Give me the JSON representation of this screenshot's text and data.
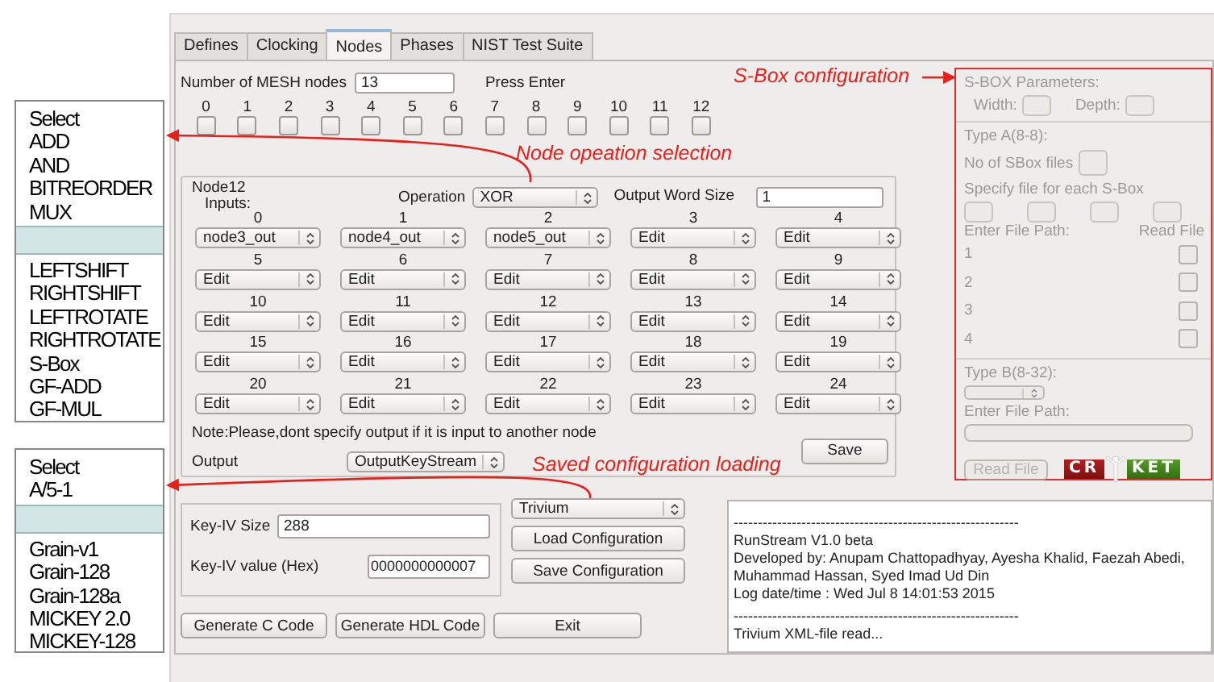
{
  "operation_list": {
    "items": [
      {
        "kind": "option",
        "label": "Select",
        "selected": false
      },
      {
        "kind": "option",
        "label": "ADD",
        "selected": false
      },
      {
        "kind": "option",
        "label": "AND",
        "selected": false
      },
      {
        "kind": "option",
        "label": "BITREORDER",
        "selected": false
      },
      {
        "kind": "option",
        "label": "MUX",
        "selected": false
      },
      {
        "kind": "blank",
        "selected": true
      },
      {
        "kind": "option",
        "label": "LEFTSHIFT",
        "selected": false
      },
      {
        "kind": "option",
        "label": "RIGHTSHIFT",
        "selected": false
      },
      {
        "kind": "option",
        "label": "LEFTROTATE",
        "selected": false
      },
      {
        "kind": "option",
        "label": "RIGHTROTATE",
        "selected": false
      },
      {
        "kind": "option",
        "label": "S-Box",
        "selected": false
      },
      {
        "kind": "option",
        "label": "GF-ADD",
        "selected": false
      },
      {
        "kind": "option",
        "label": "GF-MUL",
        "selected": false
      }
    ]
  },
  "cipher_list": {
    "items": [
      {
        "kind": "option",
        "label": "Select",
        "selected": false
      },
      {
        "kind": "option",
        "label": "A/5-1",
        "selected": false
      },
      {
        "kind": "blank",
        "selected": true
      },
      {
        "kind": "option",
        "label": "Grain-v1",
        "selected": false
      },
      {
        "kind": "option",
        "label": "Grain-128",
        "selected": false
      },
      {
        "kind": "option",
        "label": "Grain-128a",
        "selected": false
      },
      {
        "kind": "option",
        "label": "MICKEY 2.0",
        "selected": false
      },
      {
        "kind": "option",
        "label": "MICKEY-128",
        "selected": false
      }
    ]
  },
  "annotations": [
    {
      "text": "S-Box configuration"
    },
    {
      "text": "Node opeation selection"
    },
    {
      "text": "Saved configuration loading"
    }
  ],
  "window": {
    "tabs": [
      {
        "label": "Defines",
        "selected": false
      },
      {
        "label": "Clocking",
        "selected": false
      },
      {
        "label": "Nodes",
        "selected": true
      },
      {
        "label": "Phases",
        "selected": false
      },
      {
        "label": "NIST Test Suite",
        "selected": false
      }
    ],
    "mesh": {
      "label": "Number of MESH nodes",
      "value": "13",
      "hint": "Press Enter"
    },
    "node_checkboxes": [
      {
        "label": "0",
        "checked": false
      },
      {
        "label": "1",
        "checked": false
      },
      {
        "label": "2",
        "checked": false
      },
      {
        "label": "3",
        "checked": false
      },
      {
        "label": "4",
        "checked": false
      },
      {
        "label": "5",
        "checked": false
      },
      {
        "label": "6",
        "checked": false
      },
      {
        "label": "7",
        "checked": false
      },
      {
        "label": "8",
        "checked": false
      },
      {
        "label": "9",
        "checked": false
      },
      {
        "label": "10",
        "checked": false
      },
      {
        "label": "11",
        "checked": false
      },
      {
        "label": "12",
        "checked": false
      }
    ],
    "node": {
      "title": "Node12",
      "inputs_label": "Inputs:",
      "operation_label": "Operation",
      "operation": "XOR",
      "word_size_label": "Output Word Size",
      "word_size": "1",
      "inputs": [
        {
          "index": "0",
          "value": "node3_out"
        },
        {
          "index": "1",
          "value": "node4_out"
        },
        {
          "index": "2",
          "value": "node5_out"
        },
        {
          "index": "3",
          "value": "Edit"
        },
        {
          "index": "4",
          "value": "Edit"
        },
        {
          "index": "5",
          "value": "Edit"
        },
        {
          "index": "6",
          "value": "Edit"
        },
        {
          "index": "7",
          "value": "Edit"
        },
        {
          "index": "8",
          "value": "Edit"
        },
        {
          "index": "9",
          "value": "Edit"
        },
        {
          "index": "10",
          "value": "Edit"
        },
        {
          "index": "11",
          "value": "Edit"
        },
        {
          "index": "12",
          "value": "Edit"
        },
        {
          "index": "13",
          "value": "Edit"
        },
        {
          "index": "14",
          "value": "Edit"
        },
        {
          "index": "15",
          "value": "Edit"
        },
        {
          "index": "16",
          "value": "Edit"
        },
        {
          "index": "17",
          "value": "Edit"
        },
        {
          "index": "18",
          "value": "Edit"
        },
        {
          "index": "19",
          "value": "Edit"
        },
        {
          "index": "20",
          "value": "Edit"
        },
        {
          "index": "21",
          "value": "Edit"
        },
        {
          "index": "22",
          "value": "Edit"
        },
        {
          "index": "23",
          "value": "Edit"
        },
        {
          "index": "24",
          "value": "Edit"
        }
      ],
      "note": "Note:Please,dont specify output if it is input to another node",
      "output_label": "Output",
      "output": "OutputKeyStream",
      "save_button": "Save"
    },
    "key_iv": {
      "size_label": "Key-IV Size",
      "size": "288",
      "value_label": "Key-IV value (Hex)",
      "value": "0000000000007"
    },
    "cipher": "Trivium",
    "config_buttons": [
      "Load Configuration",
      "Save Configuration"
    ],
    "bottom_buttons": [
      "Generate C Code",
      "Generate HDL Code",
      "Exit"
    ],
    "log": [
      "-----------------------------------------------------------",
      "RunStream V1.0 beta",
      "Developed by: Anupam Chattopadhyay, Ayesha Khalid, Faezah Abedi, Muhammad Hassan, Syed Imad Ud Din",
      "Log date/time : Wed Jul 8 14:01:53 2015",
      "-----------------------------------------------------------",
      "Trivium XML-file read..."
    ],
    "sbox": {
      "disabled": true,
      "title": "S-BOX Parameters:",
      "width_label": "Width:",
      "depth_label": "Depth:",
      "type_a": "Type A(8-8):",
      "files_label": "No of SBox files",
      "specify_label": "Specify file for each S-Box",
      "path_label": "Enter File Path:",
      "read_label": "Read File",
      "files": [
        {
          "label": "1",
          "checked": false
        },
        {
          "label": "2",
          "checked": false
        },
        {
          "label": "3",
          "checked": false
        },
        {
          "label": "4",
          "checked": false
        }
      ],
      "type_b": "Type B(8-32):",
      "path_label_b": "Enter File Path:",
      "read_button": "Read File"
    },
    "logo": [
      "CR",
      "KET"
    ]
  }
}
